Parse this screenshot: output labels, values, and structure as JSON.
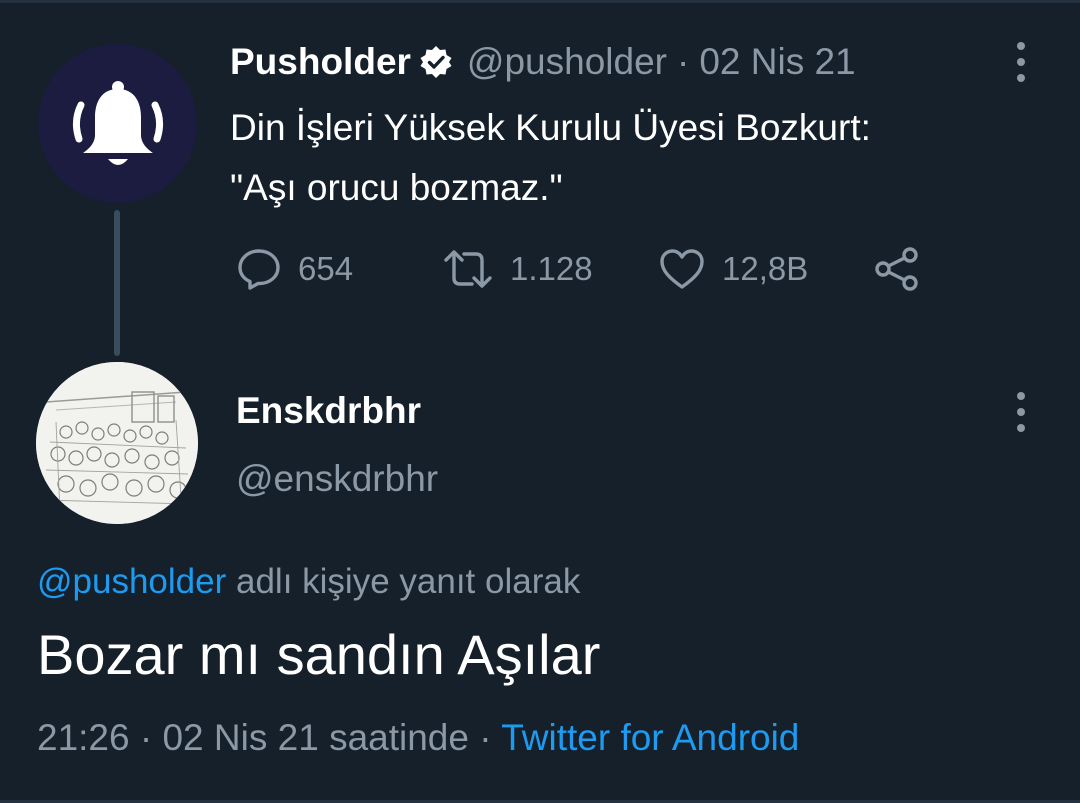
{
  "parent_tweet": {
    "display_name": "Pusholder",
    "handle": "@pusholder",
    "separator": "·",
    "date": "02 Nis 21",
    "text_line1": "Din İşleri Yüksek Kurulu Üyesi Bozkurt:",
    "text_line2": "\"Aşı orucu bozmaz.\"",
    "replies": "654",
    "retweets": "1.128",
    "likes": "12,8B",
    "avatar_icon": "bell-icon",
    "avatar_color": "#1b1c40"
  },
  "reply_tweet": {
    "display_name": "Enskdrbhr",
    "handle": "@enskdrbhr",
    "replying_to_mention": "@pusholder",
    "replying_to_suffix": "adlı kişiye yanıt olarak",
    "text": "Bozar mı sandın Aşılar",
    "time": "21:26",
    "separator1": "·",
    "date_text": "02 Nis 21 saatinde",
    "separator2": "·",
    "source": "Twitter for Android"
  },
  "colors": {
    "background": "#15202b",
    "muted_text": "#8b98a5",
    "link": "#1d9bf0",
    "thread_line": "#3a4d5f"
  }
}
